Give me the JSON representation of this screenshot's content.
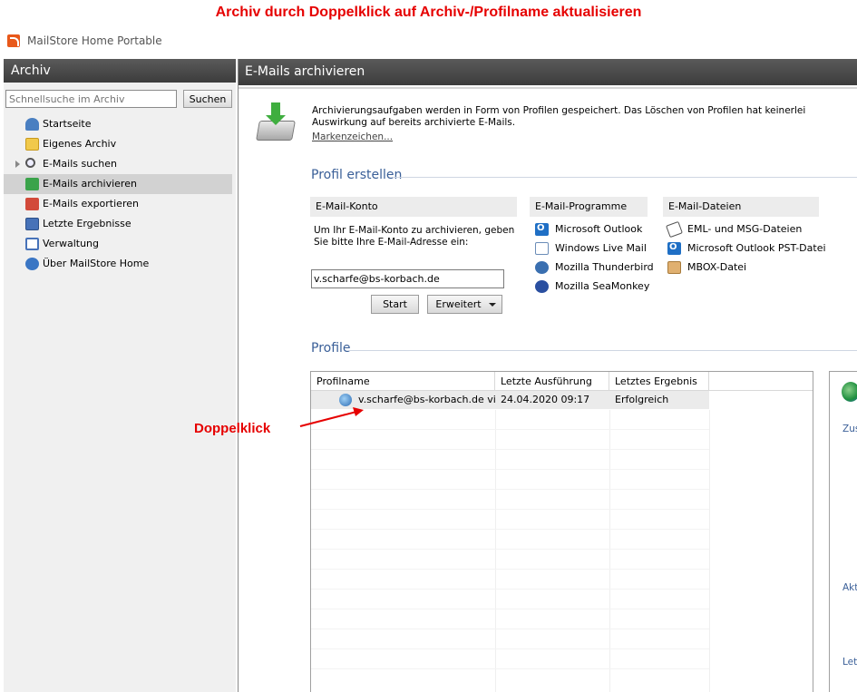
{
  "annotation": {
    "title": "Archiv durch Doppelklick auf Archiv-/Profilname aktualisieren",
    "doppelklick": "Doppelklick",
    "color": "#e60000"
  },
  "app": {
    "title": "MailStore Home Portable"
  },
  "sidebar": {
    "header": "Archiv",
    "search": {
      "placeholder": "Schnellsuche im Archiv",
      "button": "Suchen"
    },
    "items": [
      {
        "label": "Startseite",
        "icon": "home-icon"
      },
      {
        "label": "Eigenes Archiv",
        "icon": "folder-icon"
      },
      {
        "label": "E-Mails suchen",
        "icon": "search-icon"
      },
      {
        "label": "E-Mails archivieren",
        "icon": "archive-icon",
        "selected": true
      },
      {
        "label": "E-Mails exportieren",
        "icon": "export-icon"
      },
      {
        "label": "Letzte Ergebnisse",
        "icon": "results-icon"
      },
      {
        "label": "Verwaltung",
        "icon": "admin-icon"
      },
      {
        "label": "Über MailStore Home",
        "icon": "info-icon"
      }
    ]
  },
  "main": {
    "header": "E-Mails archivieren",
    "intro": "Archivierungsaufgaben werden in Form von Profilen gespeichert. Das Löschen von Profilen hat keinerlei Auswirkung auf bereits archivierte E-Mails.",
    "intro_link": "Markenzeichen...",
    "create_profile": {
      "title": "Profil erstellen",
      "konto": {
        "header": "E-Mail-Konto",
        "text": "Um Ihr E-Mail-Konto zu archivieren, geben Sie bitte Ihre E-Mail-Adresse ein:",
        "email": "v.scharfe@bs-korbach.de",
        "start": "Start",
        "advanced": "Erweitert"
      },
      "programs": {
        "header": "E-Mail-Programme",
        "items": [
          "Microsoft Outlook",
          "Windows Live Mail",
          "Mozilla Thunderbird",
          "Mozilla SeaMonkey"
        ]
      },
      "files": {
        "header": "E-Mail-Dateien",
        "items": [
          "EML- und MSG-Dateien",
          "Microsoft Outlook PST-Datei",
          "MBOX-Datei"
        ]
      }
    },
    "profiles": {
      "title": "Profile",
      "columns": [
        "Profilname",
        "Letzte Ausführung",
        "Letztes Ergebnis"
      ],
      "rows": [
        {
          "name": "v.scharfe@bs-korbach.de vi...",
          "last_run": "24.04.2020 09:17",
          "result": "Erfolgreich"
        }
      ]
    },
    "side_panel": {
      "labels": [
        "Zus",
        "Akt",
        "Letz"
      ]
    }
  }
}
